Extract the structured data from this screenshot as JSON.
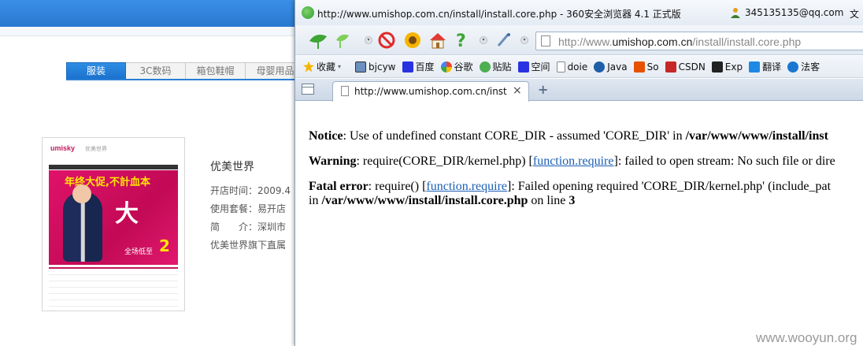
{
  "background_page": {
    "category_tabs": [
      {
        "label": "服装",
        "active": true
      },
      {
        "label": "3C数码",
        "active": false
      },
      {
        "label": "箱包鞋帽",
        "active": false
      },
      {
        "label": "母婴用品",
        "active": false
      }
    ],
    "shop": {
      "thumbnail": {
        "logo": "umisky",
        "logo_sub": "优美世界",
        "banner_title": "年终大促,不計血本",
        "banner_big": "大",
        "sale_text": "全场低至",
        "sale_number": "2"
      },
      "name": "优美世界",
      "open_time": "开店时间：2009.4",
      "package": "使用套餐：易开店",
      "intro": "简　　介：深圳市",
      "desc": "优美世界旗下直属"
    }
  },
  "browser": {
    "title": "http://www.umishop.com.cn/install/install.core.php - 360安全浏览器 4.1 正式版",
    "user_email": "345135135@qq.com",
    "file_menu": "文",
    "address_prefix": "http://www.",
    "address_domain": "umishop.com.cn",
    "address_path": "/install/install.core.php",
    "bookmarks": [
      {
        "label": "收藏",
        "icon": "star-icon",
        "color": "#f4b400"
      },
      {
        "label": "bjcyw",
        "icon": "image-icon",
        "color": "#6b8fbf"
      },
      {
        "label": "百度",
        "icon": "paw-icon",
        "color": "#2932e1"
      },
      {
        "label": "谷歌",
        "icon": "google-icon",
        "color": "#34a853"
      },
      {
        "label": "贴贴",
        "icon": "frog-icon",
        "color": "#4caf50"
      },
      {
        "label": "空间",
        "icon": "paw-icon",
        "color": "#2932e1"
      },
      {
        "label": "doie",
        "icon": "page-icon",
        "color": "#e8e8e8"
      },
      {
        "label": "Java",
        "icon": "refresh-icon",
        "color": "#1e5fa8"
      },
      {
        "label": "So",
        "icon": "so-icon",
        "color": "#e65100"
      },
      {
        "label": "CSDN",
        "icon": "csdn-icon",
        "color": "#c62828"
      },
      {
        "label": "Exp",
        "icon": "exp-icon",
        "color": "#222222"
      },
      {
        "label": "翻译",
        "icon": "translate-icon",
        "color": "#1e88e5"
      },
      {
        "label": "法客",
        "icon": "c-icon",
        "color": "#1976d2"
      }
    ],
    "tab": {
      "title": "http://www.umishop.com.cn/inst...",
      "close": "×",
      "new_tab": "+"
    },
    "content": {
      "notice_label": "Notice",
      "notice_text": ": Use of undefined constant CORE_DIR - assumed 'CORE_DIR' in ",
      "notice_path": "/var/www/www/install/inst",
      "warning_label": "Warning",
      "warning_text1": ": require(CORE_DIR/kernel.php) [",
      "warning_link": "function.require",
      "warning_text2": "]: failed to open stream: No such file or dire",
      "fatal_label": "Fatal error",
      "fatal_text1": ": require() [",
      "fatal_link": "function.require",
      "fatal_text2": "]: Failed opening required 'CORE_DIR/kernel.php' (include_pat",
      "fatal_line2_prefix": "in ",
      "fatal_path": "/var/www/www/install/install.core.php",
      "fatal_line2_mid": " on line ",
      "fatal_line_number": "3"
    }
  },
  "watermark": "www.wooyun.org"
}
